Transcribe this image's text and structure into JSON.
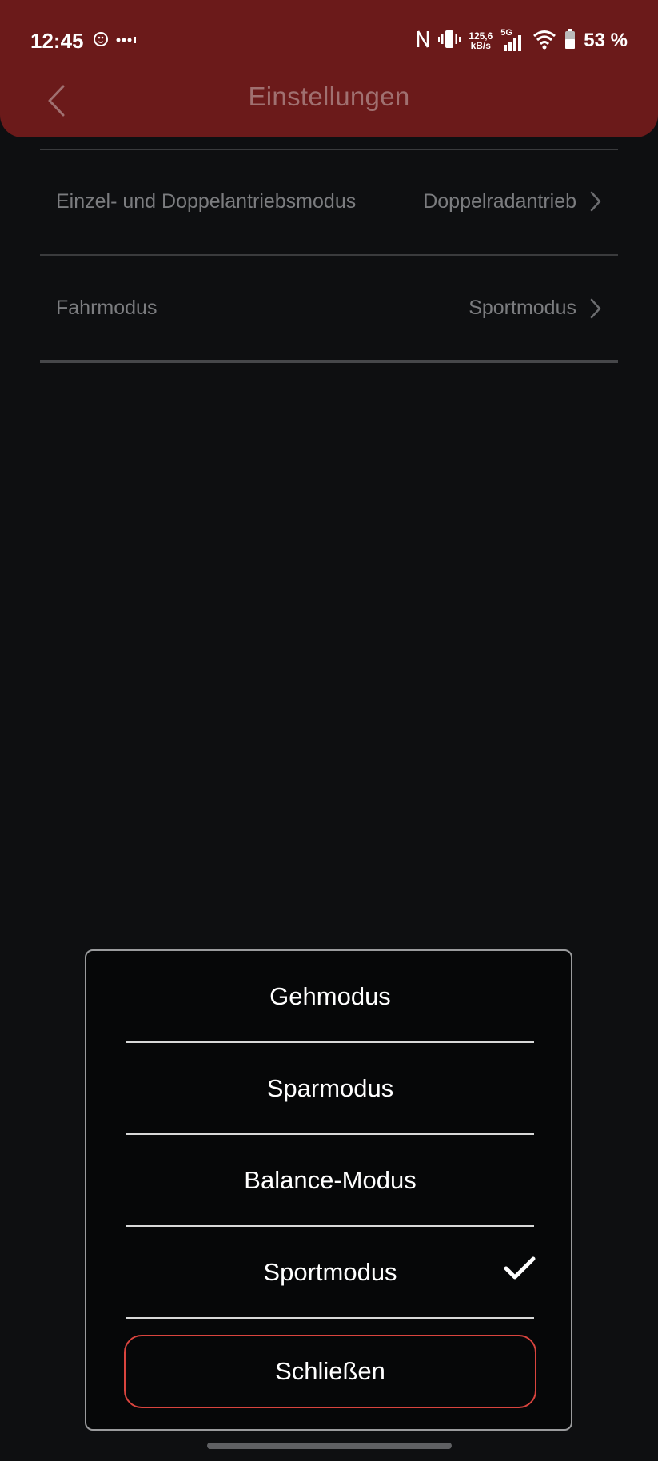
{
  "status_bar": {
    "time": "12:45",
    "net_speed_value": "125,6",
    "net_speed_unit": "kB/s",
    "network_type": "5G",
    "battery_percent": "53 %"
  },
  "header": {
    "title": "Einstellungen",
    "bg_color": "#6b1a1a"
  },
  "settings": {
    "items": [
      {
        "label": "Einzel- und Doppelantriebsmodus",
        "value": "Doppelradantrieb"
      },
      {
        "label": "Fahrmodus",
        "value": "Sportmodus"
      }
    ]
  },
  "mode_picker": {
    "options": [
      {
        "label": "Gehmodus",
        "selected": false
      },
      {
        "label": "Sparmodus",
        "selected": false
      },
      {
        "label": "Balance-Modus",
        "selected": false
      },
      {
        "label": "Sportmodus",
        "selected": true
      }
    ],
    "close_label": "Schließen",
    "close_border_color": "#d9443e"
  }
}
